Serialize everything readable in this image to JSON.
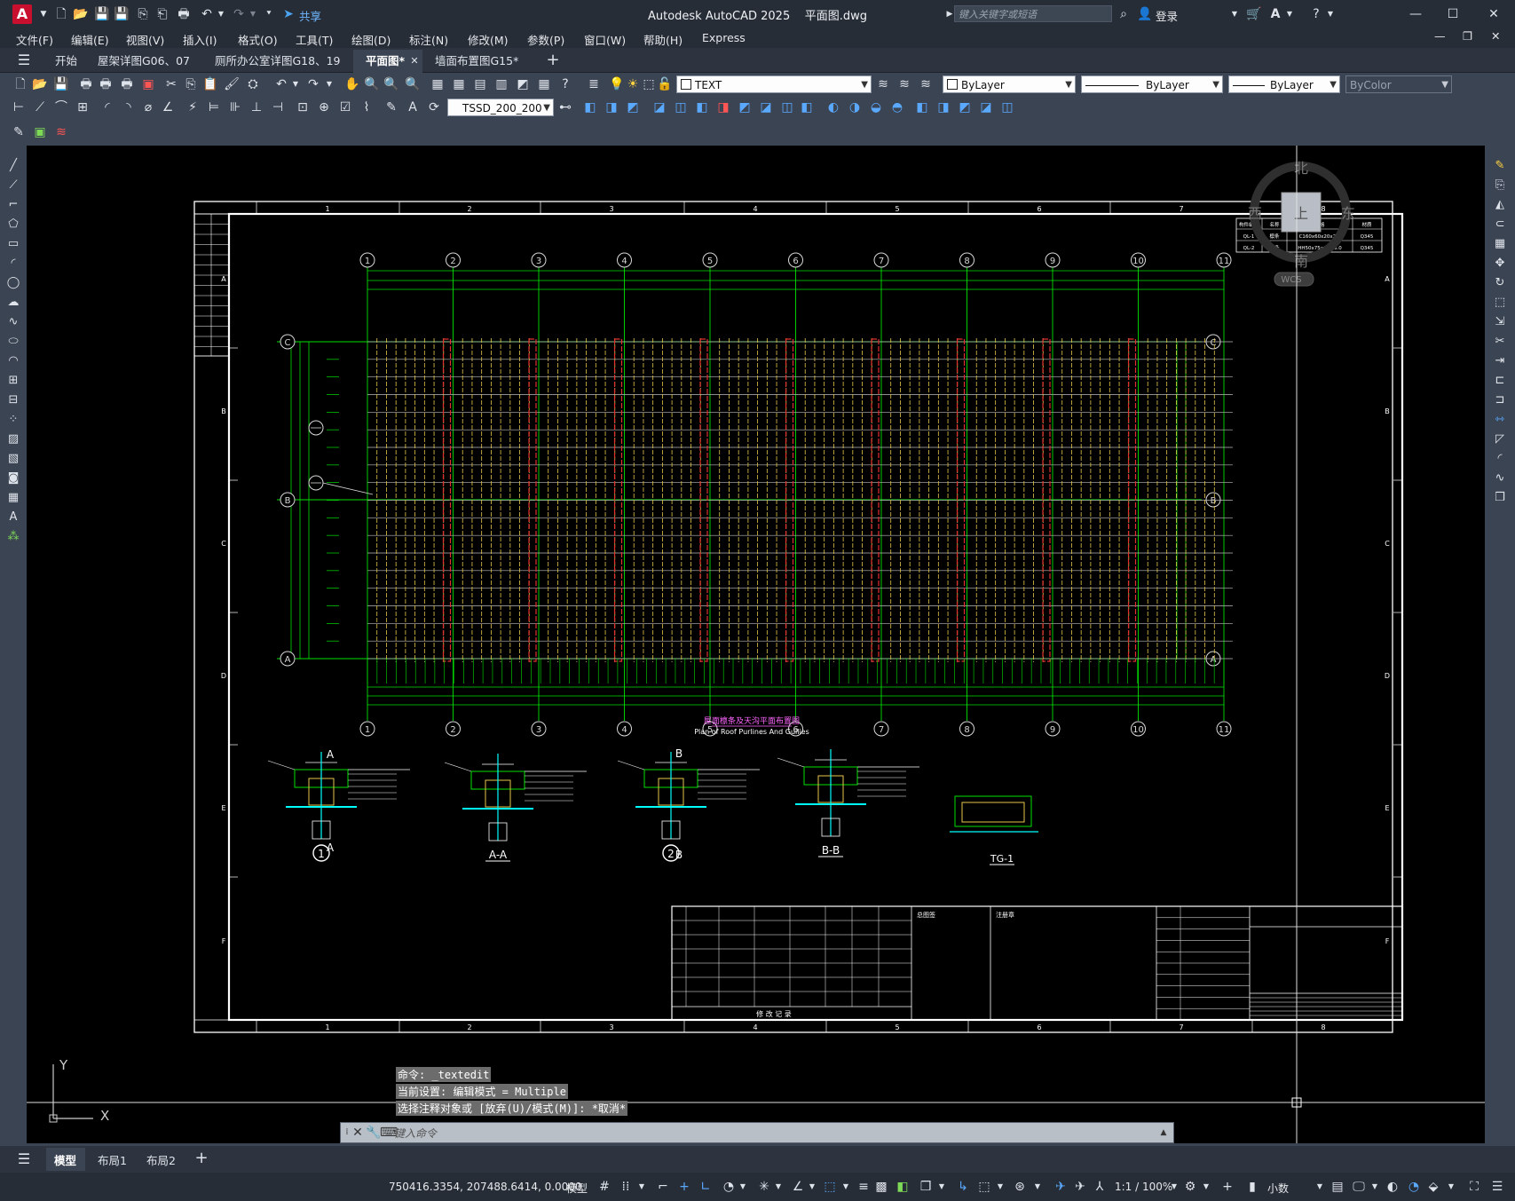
{
  "app": {
    "title": "Autodesk AutoCAD 2025",
    "file": "平面图.dwg",
    "share_label": "共享",
    "search_placeholder": "键入关键字或短语",
    "login_label": "登录"
  },
  "menu": [
    "文件(F)",
    "编辑(E)",
    "视图(V)",
    "插入(I)",
    "格式(O)",
    "工具(T)",
    "绘图(D)",
    "标注(N)",
    "修改(M)",
    "参数(P)",
    "窗口(W)",
    "帮助(H)",
    "Express"
  ],
  "tabs": [
    {
      "label": "开始",
      "active": false
    },
    {
      "label": "屋架详图G06、07",
      "active": false
    },
    {
      "label": "厕所办公室详图G18、19",
      "active": false
    },
    {
      "label": "平面图*",
      "active": true
    },
    {
      "label": "墙面布置图G15*",
      "active": false
    }
  ],
  "properties": {
    "layer": "TEXT",
    "color": "ByLayer",
    "linetype": "ByLayer",
    "lineweight": "ByLayer",
    "plotstyle": "ByColor",
    "textstyle": "TSSD_200_200"
  },
  "viewcube": {
    "north": "北",
    "south": "南",
    "east": "东",
    "west": "西",
    "top": "上",
    "wcs": "WCS"
  },
  "drawing": {
    "grid_numbers": [
      "1",
      "2",
      "3",
      "4",
      "5",
      "6",
      "7",
      "8",
      "9",
      "10",
      "11"
    ],
    "grid_letters": [
      "C",
      "B",
      "A"
    ],
    "border_cols": [
      "1",
      "2",
      "3",
      "4",
      "5",
      "6",
      "7",
      "8"
    ],
    "border_rows": [
      "A",
      "B",
      "C",
      "D",
      "E",
      "F"
    ],
    "plan_title_cn": "屋面檩条及天沟平面布置图",
    "plan_title_en": "Plan of Roof Purlines And Gullies",
    "details": [
      "1",
      "A-A",
      "2",
      "B-B",
      "TG-1"
    ],
    "section_marks": [
      "A",
      "A",
      "B",
      "B"
    ],
    "table_headers": [
      "构件编号",
      "名称",
      "规格",
      "材质"
    ],
    "table_rows": [
      [
        "QL-1",
        "檩条",
        "C160x60x20x2.0",
        "Q345"
      ],
      [
        "QL-2",
        "檩条",
        "HH50x75x4.5x6.0",
        "Q345"
      ]
    ],
    "revision_label": "修 改 记 录",
    "title_block_notes": [
      "总图签",
      "注册章"
    ],
    "axis_x": "X",
    "axis_y": "Y"
  },
  "command_history": [
    "命令: _textedit",
    "当前设置: 编辑模式 = Multiple",
    "选择注释对象或 [放弃(U)/模式(M)]: *取消*"
  ],
  "command_placeholder": "键入命令",
  "layout_tabs": [
    {
      "label": "模型",
      "active": true
    },
    {
      "label": "布局1",
      "active": false
    },
    {
      "label": "布局2",
      "active": false
    }
  ],
  "status": {
    "coords": "750416.3354, 207488.6414, 0.0000",
    "mode": "模型",
    "scale": "1:1 / 100%",
    "units": "小数"
  }
}
